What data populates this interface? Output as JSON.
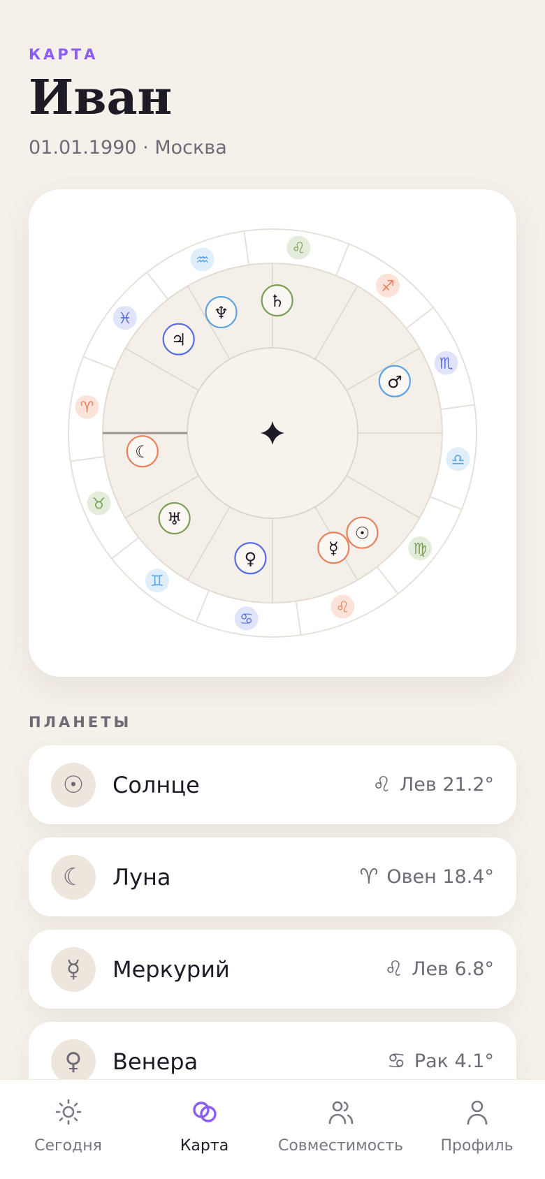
{
  "header": {
    "eyebrow": "КАРТА",
    "name": "Иван",
    "details": "01.01.1990 · Москва"
  },
  "chart": {
    "center_icon": "four-point-star-icon",
    "signs": [
      {
        "glyph": "♌",
        "name": "leo-icon",
        "color": "#7fa05a",
        "bg": "#e4ecdb"
      },
      {
        "glyph": "♐",
        "name": "sagittarius-icon",
        "color": "#e8825e",
        "bg": "#fbe3da"
      },
      {
        "glyph": "♏",
        "name": "scorpio-icon",
        "color": "#5b6fe0",
        "bg": "#e0e4fa"
      },
      {
        "glyph": "♎",
        "name": "libra-icon",
        "color": "#5ea4e2",
        "bg": "#dfeefb"
      },
      {
        "glyph": "♍",
        "name": "virgo-icon",
        "color": "#7fa05a",
        "bg": "#e4ecdb"
      },
      {
        "glyph": "♌",
        "name": "leo-icon",
        "color": "#e8825e",
        "bg": "#fbe3da"
      },
      {
        "glyph": "♋",
        "name": "cancer-icon",
        "color": "#5b6fe0",
        "bg": "#e0e4fa"
      },
      {
        "glyph": "♊",
        "name": "gemini-icon",
        "color": "#5ea4e2",
        "bg": "#dfeefb"
      },
      {
        "glyph": "♉",
        "name": "taurus-icon",
        "color": "#7fa05a",
        "bg": "#e4ecdb"
      },
      {
        "glyph": "♈",
        "name": "aries-icon",
        "color": "#e8825e",
        "bg": "#fbe3da"
      },
      {
        "glyph": "♓",
        "name": "pisces-icon",
        "color": "#5b6fe0",
        "bg": "#e0e4fa"
      },
      {
        "glyph": "♒",
        "name": "aquarius-icon",
        "color": "#5ea4e2",
        "bg": "#dfeefb"
      }
    ],
    "planets": [
      {
        "glyph": "♄",
        "name": "saturn-icon",
        "color": "#7fa05a"
      },
      {
        "glyph": "♆",
        "name": "neptune-icon",
        "color": "#5ea4e2"
      },
      {
        "glyph": "♃",
        "name": "jupiter-icon",
        "color": "#5b6fe0"
      },
      {
        "glyph": "☾",
        "name": "moon-icon",
        "color": "#e8825e"
      },
      {
        "glyph": "♅",
        "name": "uranus-icon",
        "color": "#7fa05a"
      },
      {
        "glyph": "♀",
        "name": "venus-icon",
        "color": "#5b6fe0"
      },
      {
        "glyph": "☿",
        "name": "mercury-icon",
        "color": "#e8825e"
      },
      {
        "glyph": "☉",
        "name": "sun-icon",
        "color": "#e8825e"
      },
      {
        "glyph": "♂",
        "name": "mars-icon",
        "color": "#5ea4e2"
      }
    ]
  },
  "planets_section": {
    "label": "ПЛАНЕТЫ",
    "items": [
      {
        "glyph": "☉",
        "icon": "sun-icon",
        "name": "Солнце",
        "sign_glyph": "♌",
        "sign_icon": "leo-icon",
        "position": "Лев 21.2°"
      },
      {
        "glyph": "☾",
        "icon": "moon-icon",
        "name": "Луна",
        "sign_glyph": "♈",
        "sign_icon": "aries-icon",
        "position": "Овен 18.4°"
      },
      {
        "glyph": "☿",
        "icon": "mercury-icon",
        "name": "Меркурий",
        "sign_glyph": "♌",
        "sign_icon": "leo-icon",
        "position": "Лев 6.8°"
      },
      {
        "glyph": "♀",
        "icon": "venus-icon",
        "name": "Венера",
        "sign_glyph": "♋",
        "sign_icon": "cancer-icon",
        "position": "Рак 4.1°"
      }
    ]
  },
  "tabbar": {
    "today": "Сегодня",
    "chart": "Карта",
    "compatibility": "Совместимость",
    "profile": "Профиль",
    "accent": "#8b5cf6"
  }
}
